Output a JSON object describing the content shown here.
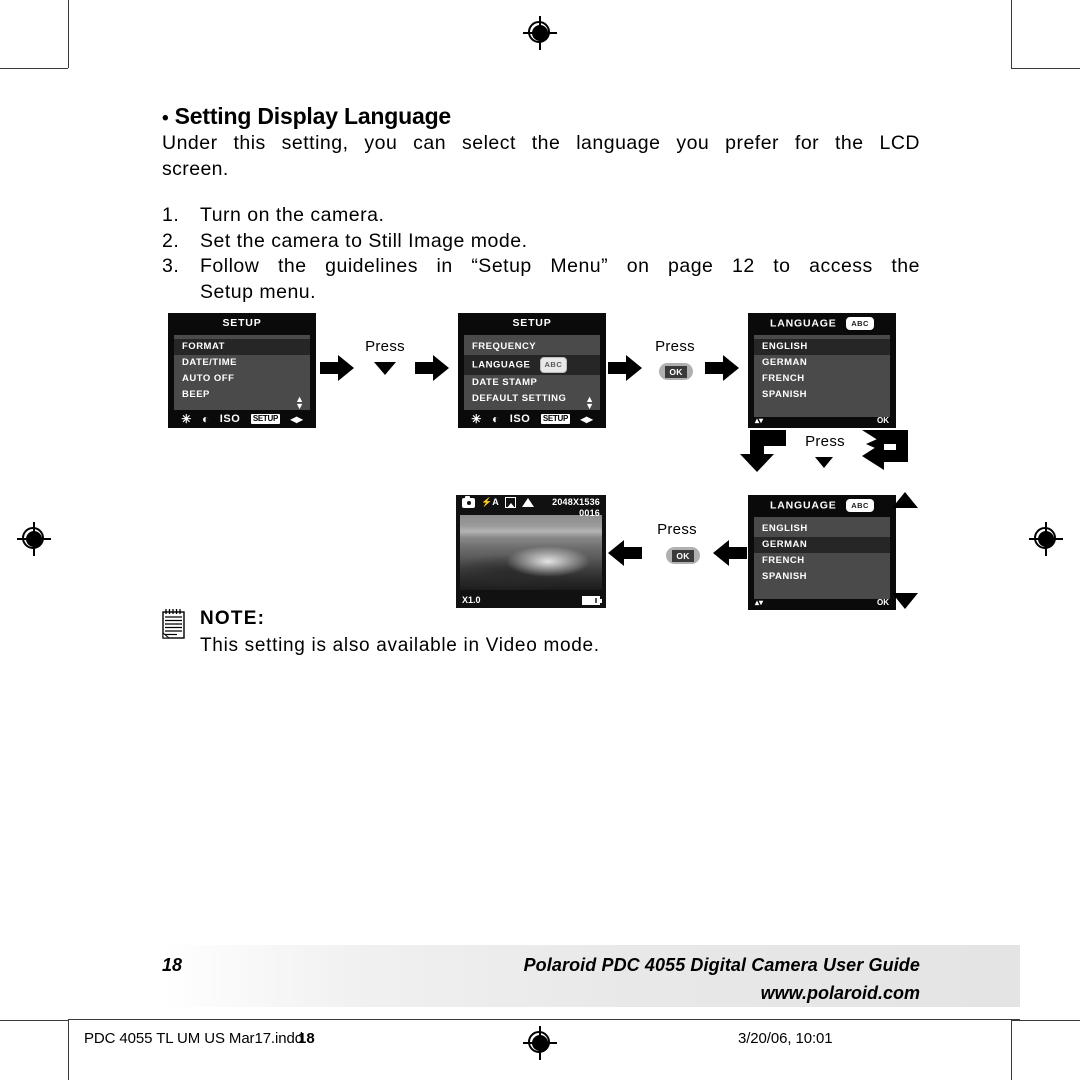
{
  "page": {
    "heading_bullet": "•",
    "heading": "Setting Display Language",
    "intro_line1": "Under this setting, you can select the language you prefer for the LCD",
    "intro_line2": "screen.",
    "steps": [
      {
        "num": "1.",
        "text": "Turn on the camera."
      },
      {
        "num": "2.",
        "text": "Set the camera to Still Image mode."
      },
      {
        "num": "3.",
        "line1": "Follow the guidelines in “Setup Menu” on page 12 to access the",
        "line2": "Setup menu."
      }
    ]
  },
  "lcd_setup_1": {
    "title": "SETUP",
    "items": [
      {
        "label": "FORMAT",
        "selected": true
      },
      {
        "label": "DATE/TIME",
        "selected": false
      },
      {
        "label": "AUTO OFF",
        "selected": false
      },
      {
        "label": "BEEP",
        "selected": false
      }
    ],
    "scroll": "▴▾",
    "footer_icons": [
      "brightness-icon",
      "contrast-icon",
      "ISO",
      "SETUP",
      "left-right-icon"
    ],
    "footer_iso_label": "ISO",
    "footer_setup_label": "SETUP",
    "footer_leftright": "◂▸"
  },
  "lcd_setup_2": {
    "title": "SETUP",
    "items": [
      {
        "label": "FREQUENCY",
        "selected": false,
        "chip": ""
      },
      {
        "label": "LANGUAGE",
        "selected": true,
        "chip": "ABC"
      },
      {
        "label": "DATE STAMP",
        "selected": false,
        "chip": ""
      },
      {
        "label": "DEFAULT SETTING",
        "selected": false,
        "chip": ""
      }
    ],
    "scroll": "▴▾",
    "footer_iso_label": "ISO",
    "footer_setup_label": "SETUP",
    "footer_leftright": "◂▸"
  },
  "lcd_language_1": {
    "title": "LANGUAGE",
    "title_chip": "ABC",
    "items": [
      {
        "label": "ENGLISH",
        "selected": true
      },
      {
        "label": "GERMAN",
        "selected": false
      },
      {
        "label": "FRENCH",
        "selected": false
      },
      {
        "label": "SPANISH",
        "selected": false
      }
    ],
    "footer_left": "▴▾",
    "footer_right": "OK"
  },
  "lcd_language_2": {
    "title": "LANGUAGE",
    "title_chip": "ABC",
    "items": [
      {
        "label": "ENGLISH",
        "selected": false
      },
      {
        "label": "GERMAN",
        "selected": true
      },
      {
        "label": "FRENCH",
        "selected": false
      },
      {
        "label": "SPANISH",
        "selected": false
      }
    ],
    "footer_left": "▴▾",
    "footer_right": "OK"
  },
  "lcd_preview": {
    "icons": [
      "camera-mode-icon",
      "flash-auto-icon",
      "white-balance-icon",
      "macro-landscape-icon"
    ],
    "flash_label": "⚡A",
    "resolution": "2048X1536",
    "shots_remaining": "0016",
    "zoom_label": "X1.0",
    "battery": "battery-icon"
  },
  "flow": {
    "press_1": "Press",
    "press_1_control": "down-arrow",
    "press_2": "Press",
    "press_2_control": "OK",
    "press_3": "Press",
    "press_3_control": "down-arrow",
    "press_4": "Press",
    "press_4_control": "OK",
    "ok_label": "OK"
  },
  "note": {
    "label": "NOTE:",
    "text": "This setting is also available in Video mode."
  },
  "footer": {
    "page_number": "18",
    "title": "Polaroid PDC 4055 Digital Camera User Guide",
    "url": "www.polaroid.com"
  },
  "production": {
    "filename": "PDC 4055 TL UM US Mar17.indd",
    "page_stamp": "18",
    "timestamp": "3/20/06, 10:01"
  },
  "colors": {
    "lcd_bg": "#0a0a0a",
    "lcd_list_bg": "#4a4a4a",
    "lcd_selected": "#262626",
    "footer_band": "#e8e8e8"
  }
}
